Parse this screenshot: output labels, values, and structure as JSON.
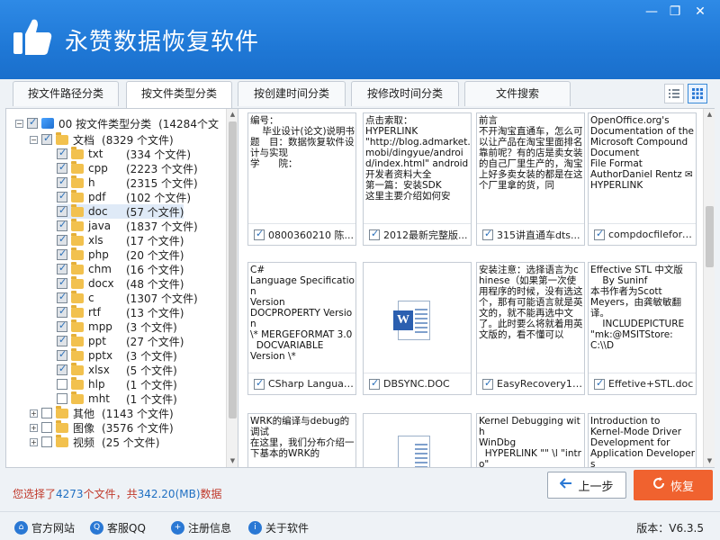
{
  "app": {
    "title": "永赞数据恢复软件",
    "accent": "#1f78d6",
    "window_controls": [
      "minimize",
      "restore",
      "close"
    ]
  },
  "tabs": [
    {
      "label": "按文件路径分类",
      "active": false
    },
    {
      "label": "按文件类型分类",
      "active": true
    },
    {
      "label": "按创建时间分类",
      "active": false
    },
    {
      "label": "按修改时间分类",
      "active": false
    },
    {
      "label": "文件搜索",
      "active": false
    }
  ],
  "view_modes": [
    "list-view-icon",
    "grid-view-icon"
  ],
  "tree": {
    "root": {
      "name": "00 按文件类型分类",
      "count": "(14284个文"
    },
    "documents": {
      "name": "文档",
      "count": "(8329 个文件)"
    },
    "doc_types": [
      {
        "name": "txt",
        "count": "(334 个文件)",
        "checked": true
      },
      {
        "name": "cpp",
        "count": "(2223 个文件)",
        "checked": true
      },
      {
        "name": "h",
        "count": "(2315 个文件)",
        "checked": true
      },
      {
        "name": "pdf",
        "count": "(102 个文件)",
        "checked": true
      },
      {
        "name": "doc",
        "count": "(57 个文件)",
        "checked": true,
        "selected": true
      },
      {
        "name": "java",
        "count": "(1837 个文件)",
        "checked": true
      },
      {
        "name": "xls",
        "count": "(17 个文件)",
        "checked": true
      },
      {
        "name": "php",
        "count": "(20 个文件)",
        "checked": true
      },
      {
        "name": "chm",
        "count": "(16 个文件)",
        "checked": true
      },
      {
        "name": "docx",
        "count": "(48 个文件)",
        "checked": true
      },
      {
        "name": "c",
        "count": "(1307 个文件)",
        "checked": true
      },
      {
        "name": "rtf",
        "count": "(13 个文件)",
        "checked": true
      },
      {
        "name": "mpp",
        "count": "(3 个文件)",
        "checked": true
      },
      {
        "name": "ppt",
        "count": "(27 个文件)",
        "checked": true
      },
      {
        "name": "pptx",
        "count": "(3 个文件)",
        "checked": true
      },
      {
        "name": "xlsx",
        "count": "(5 个文件)",
        "checked": true
      },
      {
        "name": "hlp",
        "count": "(1 个文件)",
        "checked": false
      },
      {
        "name": "mht",
        "count": "(1 个文件)",
        "checked": false
      }
    ],
    "others": [
      {
        "name": "其他",
        "count": "(1143 个文件)"
      },
      {
        "name": "图像",
        "count": "(3576 个文件)"
      },
      {
        "name": "视频",
        "count": "(25 个文件)"
      }
    ]
  },
  "cards": [
    {
      "preview": "编号：\n    毕业设计(论文)说明书\n题　目：数据恢复软件设计与实现\n学　　院：",
      "name": "0800360210 陈...",
      "checked": true
    },
    {
      "preview": "点击索取：\nHYPERLINK\n\"http://blog.admarket.mobi/dingyue/android/index.html\" android开发者资料大全\n第一篇：安装SDK\n这里主要介绍如何安",
      "name": "2012最新完整版...",
      "checked": true
    },
    {
      "preview": "前言\n不开淘宝直通车，怎么可以让产品在淘宝里面排名靠前呢？有的店是卖女装的自己厂里生产的，淘宝上好多卖女装的都是在这个厂里拿的货，同",
      "name": "315讲直通车dts...",
      "checked": true
    },
    {
      "preview": "OpenOffice.org's\nDocumentation of the\nMicrosoft Compound\nDocument\nFile Format\nAuthorDaniel Rentz ✉\nHYPERLINK",
      "name": "compdocfileforma...",
      "checked": true
    },
    {
      "preview": "C#\nLanguage Specification\nVersion\nDOCPROPERTY Version\n\\* MERGEFORMAT 3.0\n  DOCVARIABLE\nVersion \\*",
      "name": "CSharp Language...",
      "checked": true
    },
    {
      "preview": "",
      "name": "DBSYNC.DOC",
      "checked": true,
      "icon": "word-doc-icon"
    },
    {
      "preview": "安装注意：选择语言为chinese（如果第一次使用程序的时候，没有选这个，那有可能语言就是英文的，就不能再选中文了。此时要么将就着用英文版的，看不懂可以",
      "name": "EasyRecovery10...",
      "checked": true
    },
    {
      "preview": "Effective STL 中文版\n    By Suninf\n本书作者为Scott\nMeyers，由龚敏敏翻译。\n    INCLUDEPICTURE\n\"mk:@MSITStore:C:\\\\D",
      "name": "Effetive+STL.doc",
      "checked": true
    },
    {
      "preview": "WRK的编译与debug的调试\n在这里，我们分布介绍一下基本的WRK的",
      "name": "",
      "checked": false
    },
    {
      "preview": "",
      "name": "",
      "checked": false,
      "icon": "doc-page-icon"
    },
    {
      "preview": "Kernel Debugging with\nWinDbg\n  HYPERLINK \"\" \\l \"intro\"\nGetting Set Up",
      "name": "",
      "checked": false
    },
    {
      "preview": "Introduction to\nKernel-Mode Driver\nDevelopment for\nApplication Developers",
      "name": "",
      "checked": false
    }
  ],
  "status": {
    "prefix": "您选择了",
    "count": "4273",
    "mid": "个文件，共",
    "size": "342.20(MB)",
    "suffix": "数据"
  },
  "buttons": {
    "back": "上一步",
    "recover": "恢复"
  },
  "footer": {
    "links": [
      {
        "label": "官方网站",
        "icon": "home-icon"
      },
      {
        "label": "客服QQ",
        "icon": "qq-icon"
      },
      {
        "label": "注册信息",
        "icon": "user-icon"
      },
      {
        "label": "关于软件",
        "icon": "info-icon"
      }
    ],
    "version": "版本：V6.3.5"
  }
}
